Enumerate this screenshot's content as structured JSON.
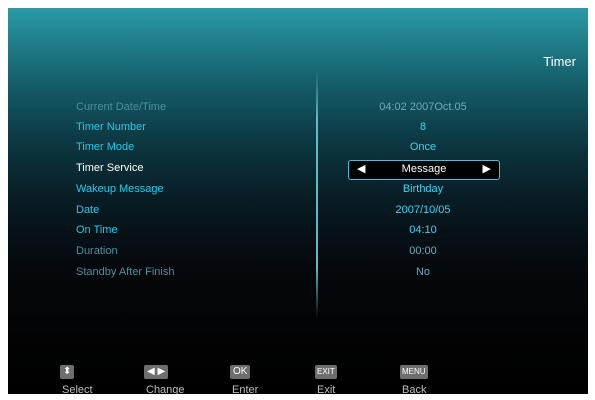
{
  "header": {
    "title": "Timer"
  },
  "rows": [
    {
      "label": "Current Date/Time",
      "value": "04:02 2007Oct.05"
    },
    {
      "label": "Timer Number",
      "value": "8"
    },
    {
      "label": "Timer Mode",
      "value": "Once"
    },
    {
      "label": "Timer Service",
      "value": "Message",
      "left_arrow": "◀",
      "right_arrow": "▶"
    },
    {
      "label": "Wakeup Message",
      "value": "Birthday"
    },
    {
      "label": "Date",
      "value": "2007/10/05"
    },
    {
      "label": "On Time",
      "value": "04:10"
    },
    {
      "label": "Duration",
      "value": "00:00"
    },
    {
      "label": "Standby After Finish",
      "value": "No"
    }
  ],
  "footer": [
    {
      "key": "⬍",
      "label": "Select"
    },
    {
      "key": "◀ ▶",
      "label": "Change"
    },
    {
      "key": "OK",
      "label": "Enter"
    },
    {
      "key": "EXIT",
      "label": "Exit"
    },
    {
      "key": "MENU",
      "label": "Back"
    }
  ],
  "colors": {
    "accent": "#22c8e8",
    "header_teal": "#2a9aa6",
    "background": "#000000"
  }
}
